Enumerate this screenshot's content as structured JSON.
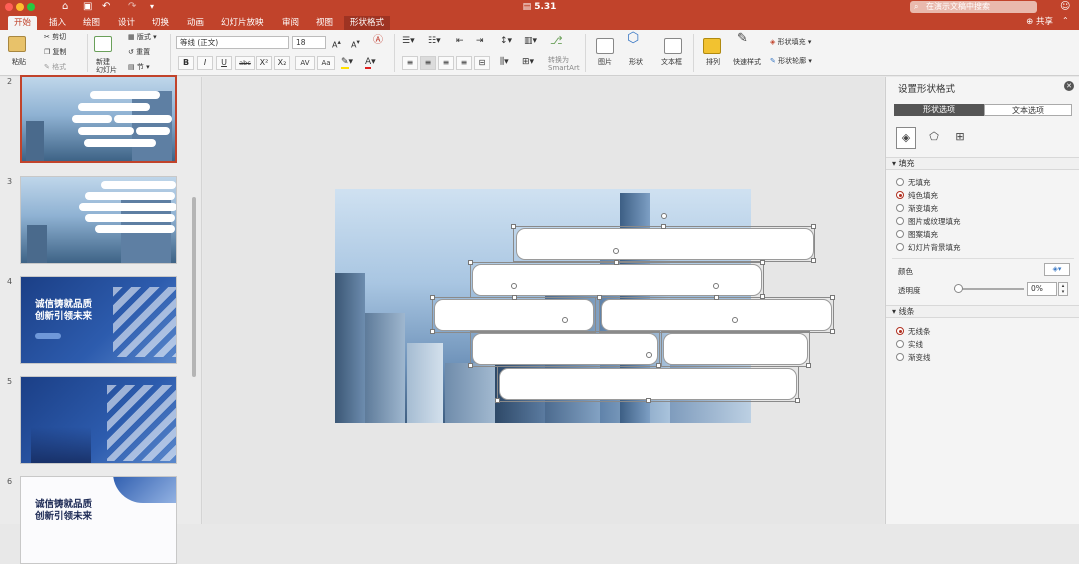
{
  "window": {
    "title": "5.31",
    "search_placeholder": "在演示文稿中搜索",
    "share_label": "共享"
  },
  "tabs": [
    {
      "label": "开始",
      "active": true
    },
    {
      "label": "插入"
    },
    {
      "label": "绘图"
    },
    {
      "label": "设计"
    },
    {
      "label": "切换"
    },
    {
      "label": "动画"
    },
    {
      "label": "幻灯片放映"
    },
    {
      "label": "审阅"
    },
    {
      "label": "视图"
    },
    {
      "label": "形状格式",
      "contextual": true
    }
  ],
  "ribbon": {
    "paste": "粘贴",
    "cut": "剪切",
    "copy": "复制",
    "format": "格式",
    "new_slide": "新建\n幻灯片",
    "layout": "版式",
    "reset": "重置",
    "section": "节",
    "font_name": "等线 (正文)",
    "font_size": "18",
    "bold": "B",
    "italic": "I",
    "underline": "U",
    "strike": "abc",
    "superscript": "X²",
    "subscript": "X₂",
    "char_spacing": "AV",
    "case": "Aa",
    "convert_smartart": "转换为\nSmartArt",
    "picture": "图片",
    "shapes": "形状",
    "textbox": "文本框",
    "arrange": "排列",
    "quick_styles": "快速样式",
    "shape_fill": "形状填充",
    "shape_outline": "形状轮廓"
  },
  "thumbnails": [
    {
      "number": "2",
      "selected": true,
      "style": "sky"
    },
    {
      "number": "3",
      "style": "sky"
    },
    {
      "number": "4",
      "style": "navy",
      "text": [
        "诚信铸就品质",
        "创新引领未来"
      ]
    },
    {
      "number": "5",
      "style": "navy"
    },
    {
      "number": "6",
      "style": "white",
      "text": [
        "诚信铸就品质",
        "创新引领未来"
      ]
    }
  ],
  "pane": {
    "title": "设置形状格式",
    "tabs": [
      "形状选项",
      "文本选项"
    ],
    "fill_section": "填充",
    "fill_options": [
      "无填充",
      "纯色填充",
      "渐变填充",
      "图片或纹理填充",
      "图案填充",
      "幻灯片背景填充"
    ],
    "fill_selected": 1,
    "color_label": "颜色",
    "transparency_label": "透明度",
    "transparency_value": "0%",
    "transparency": 0,
    "line_section": "线条",
    "line_options": [
      "无线条",
      "实线",
      "渐变线"
    ],
    "line_selected": 0
  },
  "colors": {
    "accent": "#c1432b",
    "ribbon_bg": "#f4f4f4"
  }
}
